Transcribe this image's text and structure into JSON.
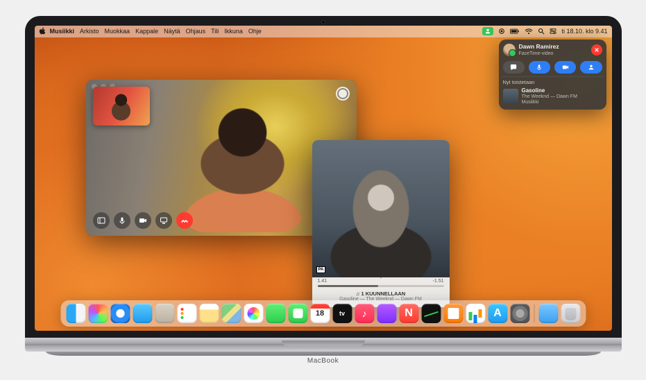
{
  "menubar": {
    "app": "Musiikki",
    "items": [
      "Arkisto",
      "Muokkaa",
      "Kappale",
      "Näytä",
      "Ohjaus",
      "Tili",
      "Ikkuna",
      "Ohje"
    ],
    "clock": "ti 18.10. klo  9.41"
  },
  "facetime": {
    "pip_label": "self-view",
    "controls": [
      "sidebar",
      "mute",
      "camera",
      "share",
      "end"
    ]
  },
  "music_player": {
    "parental": "PA",
    "elapsed": "1.41",
    "remaining": "-1.51",
    "dolby": "◊◊ Dolby Atmos",
    "listening_label": "♫ 1 KUUNNELLAAN",
    "track_line": "Gasoline — The Weeknd — Dawn FM"
  },
  "notification": {
    "caller": "Dawn Ramirez",
    "subtitle": "FaceTime-video",
    "now_playing_header": "Nyt toistetaan",
    "np_title": "Gasoline",
    "np_subtitle": "The Weeknd — Dawn FM",
    "np_app": "Musiikki"
  },
  "dock": {
    "apps": [
      "finder",
      "launchpad",
      "safari",
      "mail",
      "contacts",
      "reminders",
      "notes",
      "maps",
      "photos",
      "messages",
      "facetime",
      "calendar",
      "appletv",
      "music",
      "podcasts",
      "news",
      "stocks",
      "books",
      "numbers",
      "appstore",
      "settings"
    ],
    "right": [
      "folder",
      "trash"
    ]
  },
  "device_label": "MacBook"
}
